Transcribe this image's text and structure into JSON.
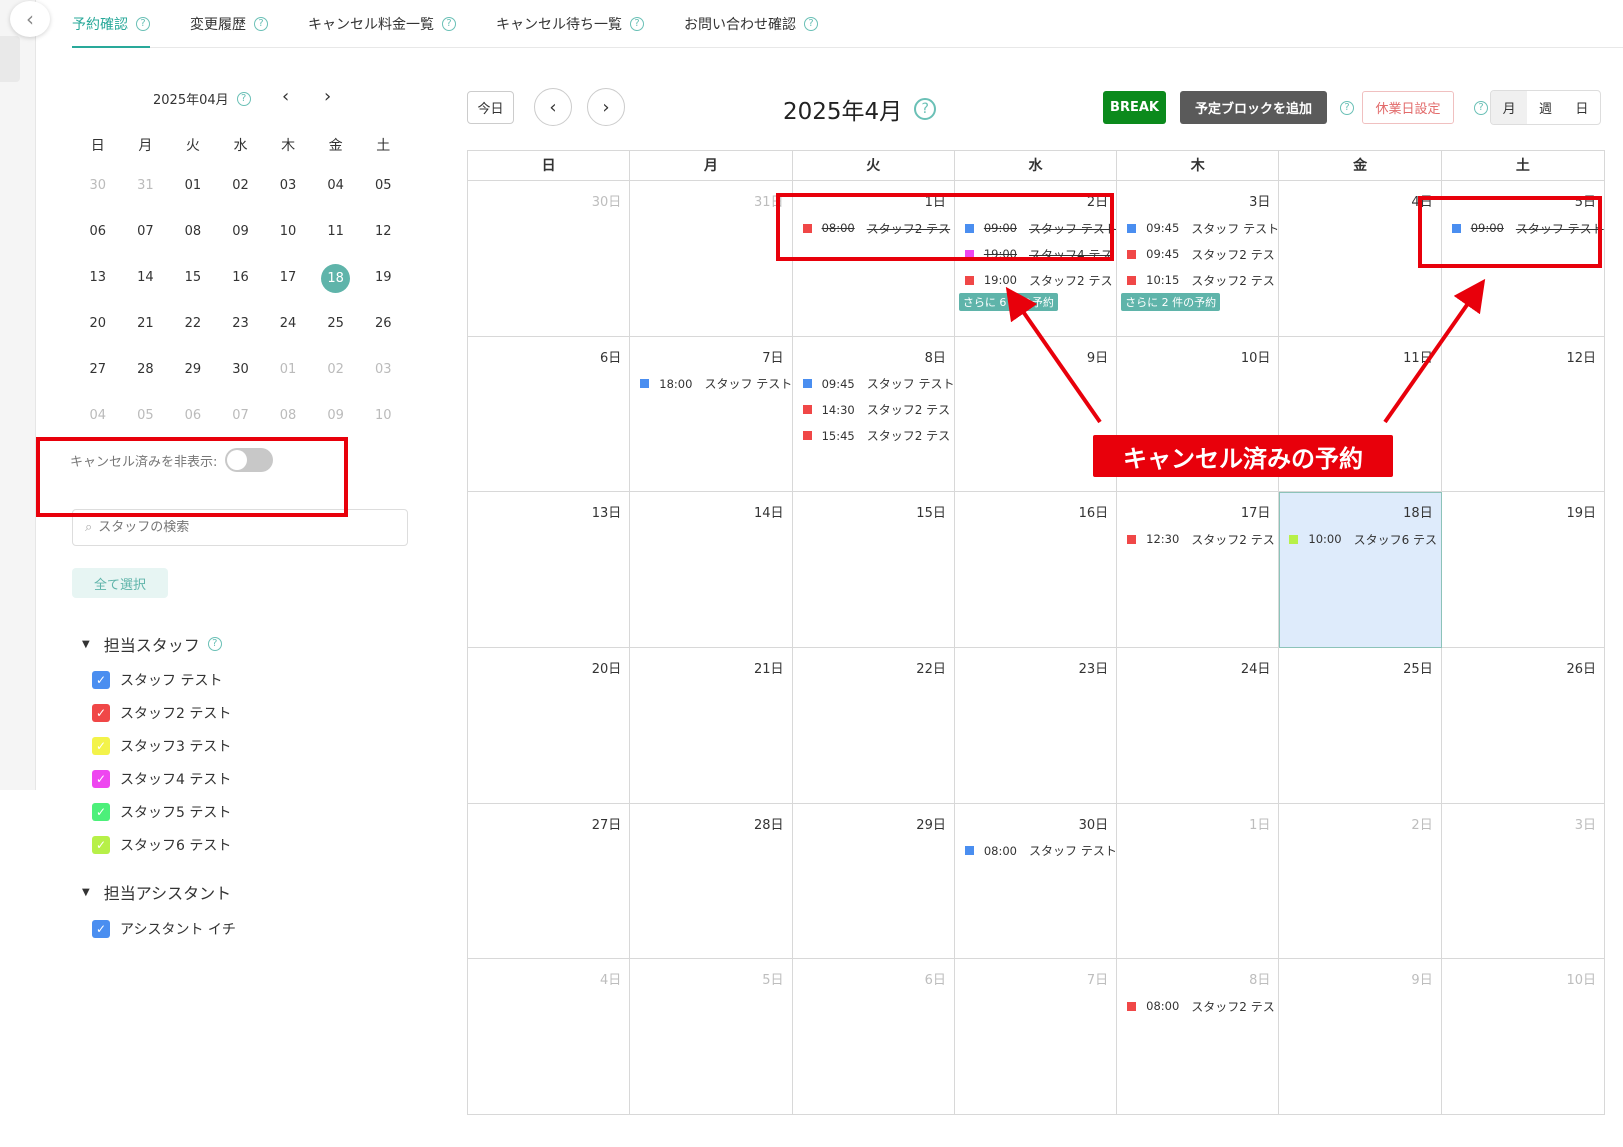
{
  "nav": {
    "tabs": [
      {
        "label": "予約確認",
        "active": true
      },
      {
        "label": "変更履歴"
      },
      {
        "label": "キャンセル料金一覧"
      },
      {
        "label": "キャンセル待ち一覧"
      },
      {
        "label": "お問い合わせ確認"
      }
    ],
    "help_glyph": "?"
  },
  "mini_calendar": {
    "title": "2025年04月",
    "weekdays": [
      "日",
      "月",
      "火",
      "水",
      "木",
      "金",
      "土"
    ],
    "days": [
      {
        "d": "30",
        "off": true
      },
      {
        "d": "31",
        "off": true
      },
      {
        "d": "01"
      },
      {
        "d": "02"
      },
      {
        "d": "03"
      },
      {
        "d": "04"
      },
      {
        "d": "05"
      },
      {
        "d": "06"
      },
      {
        "d": "07"
      },
      {
        "d": "08"
      },
      {
        "d": "09"
      },
      {
        "d": "10"
      },
      {
        "d": "11"
      },
      {
        "d": "12"
      },
      {
        "d": "13"
      },
      {
        "d": "14"
      },
      {
        "d": "15"
      },
      {
        "d": "16"
      },
      {
        "d": "17"
      },
      {
        "d": "18",
        "today": true
      },
      {
        "d": "19"
      },
      {
        "d": "20"
      },
      {
        "d": "21"
      },
      {
        "d": "22"
      },
      {
        "d": "23"
      },
      {
        "d": "24"
      },
      {
        "d": "25"
      },
      {
        "d": "26"
      },
      {
        "d": "27"
      },
      {
        "d": "28"
      },
      {
        "d": "29"
      },
      {
        "d": "30"
      },
      {
        "d": "01",
        "off": true
      },
      {
        "d": "02",
        "off": true
      },
      {
        "d": "03",
        "off": true
      },
      {
        "d": "04",
        "off": true
      },
      {
        "d": "05",
        "off": true
      },
      {
        "d": "06",
        "off": true
      },
      {
        "d": "07",
        "off": true
      },
      {
        "d": "08",
        "off": true
      },
      {
        "d": "09",
        "off": true
      },
      {
        "d": "10",
        "off": true
      }
    ]
  },
  "filters": {
    "hide_cancelled_label": "キャンセル済みを非表示:",
    "hide_cancelled_on": false,
    "search_placeholder": "スタッフの検索",
    "select_all_label": "全て選択",
    "staff_group_title": "担当スタッフ",
    "staff": [
      {
        "name": "スタッフ テスト",
        "color": "#4a8ef0",
        "checked": true
      },
      {
        "name": "スタッフ2 テスト",
        "color": "#f04747",
        "checked": true
      },
      {
        "name": "スタッフ3 テスト",
        "color": "#f3f34a",
        "checked": true
      },
      {
        "name": "スタッフ4 テスト",
        "color": "#ee46f0",
        "checked": true
      },
      {
        "name": "スタッフ5 テスト",
        "color": "#4cf07a",
        "checked": true
      },
      {
        "name": "スタッフ6 テスト",
        "color": "#b7f048",
        "checked": true
      }
    ],
    "assistant_group_title": "担当アシスタント",
    "assistants": [
      {
        "name": "アシスタント イチ",
        "color": "#4a8ef0",
        "checked": true
      }
    ]
  },
  "calendar": {
    "today_label": "今日",
    "prev_icon": "‹",
    "next_icon": "›",
    "title": "2025年4月",
    "break_label": "BREAK",
    "add_block_label": "予定ブロックを追加",
    "holiday_label": "休業日設定",
    "views": [
      "月",
      "週",
      "日"
    ],
    "active_view": "月",
    "weekdays": [
      "日",
      "月",
      "火",
      "水",
      "木",
      "金",
      "土"
    ],
    "cells": [
      {
        "d": "30日",
        "off": true,
        "events": []
      },
      {
        "d": "31日",
        "off": true,
        "events": []
      },
      {
        "d": "1日",
        "events": [
          {
            "time": "08:00",
            "name": "スタッフ2 テス",
            "color": "#f04747",
            "cancelled": true
          }
        ]
      },
      {
        "d": "2日",
        "events": [
          {
            "time": "09:00",
            "name": "スタッフ テスト",
            "color": "#4a8ef0",
            "cancelled": true
          },
          {
            "time": "19:00",
            "name": "スタッフ4 テス",
            "color": "#ee46f0",
            "cancelled": true
          },
          {
            "time": "19:00",
            "name": "スタッフ2 テス",
            "color": "#f04747"
          }
        ],
        "more": "さらに 6 件の予約"
      },
      {
        "d": "3日",
        "events": [
          {
            "time": "09:45",
            "name": "スタッフ テスト",
            "color": "#4a8ef0"
          },
          {
            "time": "09:45",
            "name": "スタッフ2 テス",
            "color": "#f04747"
          },
          {
            "time": "10:15",
            "name": "スタッフ2 テス",
            "color": "#f04747"
          }
        ],
        "more": "さらに 2 件の予約"
      },
      {
        "d": "4日",
        "events": []
      },
      {
        "d": "5日",
        "events": [
          {
            "time": "09:00",
            "name": "スタッフ テスト",
            "color": "#4a8ef0",
            "cancelled": true
          }
        ]
      },
      {
        "d": "6日",
        "events": []
      },
      {
        "d": "7日",
        "events": [
          {
            "time": "18:00",
            "name": "スタッフ テスト",
            "color": "#4a8ef0"
          }
        ]
      },
      {
        "d": "8日",
        "events": [
          {
            "time": "09:45",
            "name": "スタッフ テスト",
            "color": "#4a8ef0"
          },
          {
            "time": "14:30",
            "name": "スタッフ2 テス",
            "color": "#f04747"
          },
          {
            "time": "15:45",
            "name": "スタッフ2 テス",
            "color": "#f04747"
          }
        ]
      },
      {
        "d": "9日",
        "events": []
      },
      {
        "d": "10日",
        "events": []
      },
      {
        "d": "11日",
        "events": []
      },
      {
        "d": "12日",
        "events": []
      },
      {
        "d": "13日",
        "events": []
      },
      {
        "d": "14日",
        "events": []
      },
      {
        "d": "15日",
        "events": []
      },
      {
        "d": "16日",
        "events": []
      },
      {
        "d": "17日",
        "events": [
          {
            "time": "12:30",
            "name": "スタッフ2 テス",
            "color": "#f04747"
          }
        ]
      },
      {
        "d": "18日",
        "today": true,
        "events": [
          {
            "time": "10:00",
            "name": "スタッフ6 テス",
            "color": "#b7f048"
          }
        ]
      },
      {
        "d": "19日",
        "events": []
      },
      {
        "d": "20日",
        "events": []
      },
      {
        "d": "21日",
        "events": []
      },
      {
        "d": "22日",
        "events": []
      },
      {
        "d": "23日",
        "events": []
      },
      {
        "d": "24日",
        "events": []
      },
      {
        "d": "25日",
        "events": []
      },
      {
        "d": "26日",
        "events": []
      },
      {
        "d": "27日",
        "events": []
      },
      {
        "d": "28日",
        "events": []
      },
      {
        "d": "29日",
        "events": []
      },
      {
        "d": "30日",
        "events": [
          {
            "time": "08:00",
            "name": "スタッフ テスト",
            "color": "#4a8ef0"
          }
        ]
      },
      {
        "d": "1日",
        "off": true,
        "events": []
      },
      {
        "d": "2日",
        "off": true,
        "events": []
      },
      {
        "d": "3日",
        "off": true,
        "events": []
      },
      {
        "d": "4日",
        "off": true,
        "events": []
      },
      {
        "d": "5日",
        "off": true,
        "events": []
      },
      {
        "d": "6日",
        "off": true,
        "events": []
      },
      {
        "d": "7日",
        "off": true,
        "events": []
      },
      {
        "d": "8日",
        "off": true,
        "events": [
          {
            "time": "08:00",
            "name": "スタッフ2 テス",
            "color": "#f04747"
          }
        ]
      },
      {
        "d": "9日",
        "off": true,
        "events": []
      },
      {
        "d": "10日",
        "off": true,
        "events": []
      }
    ]
  },
  "annotation": {
    "label": "キャンセル済みの予約",
    "color": "#e8000b"
  }
}
